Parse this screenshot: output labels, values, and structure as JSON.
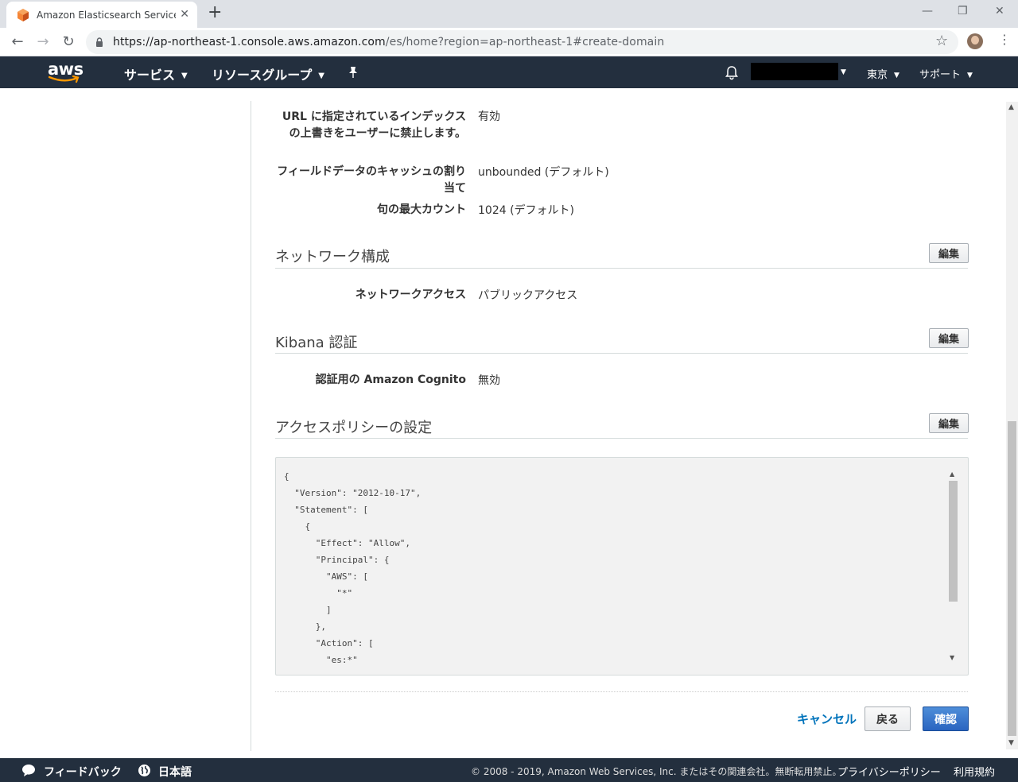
{
  "browser": {
    "tab_title": "Amazon Elasticsearch Service Ma",
    "url_host": "https://ap-northeast-1.console.aws.amazon.com",
    "url_path": "/es/home?region=ap-northeast-1#create-domain"
  },
  "aws_header": {
    "logo_text": "aws",
    "services_label": "サービス",
    "resource_groups_label": "リソースグループ",
    "region_label": "東京",
    "support_label": "サポート"
  },
  "advanced": {
    "rows": [
      {
        "label": "URL に指定されているインデックスの上書きをユーザーに禁止します。",
        "value": "有効"
      },
      {
        "label": "フィールドデータのキャッシュの割り当て",
        "value": "unbounded (デフォルト)"
      },
      {
        "label": "句の最大カウント",
        "value": "1024 (デフォルト)"
      }
    ]
  },
  "network": {
    "title": "ネットワーク構成",
    "edit_label": "編集",
    "label": "ネットワークアクセス",
    "value": "パブリックアクセス"
  },
  "kibana": {
    "title": "Kibana 認証",
    "edit_label": "編集",
    "label": "認証用の Amazon Cognito",
    "value": "無効"
  },
  "policy": {
    "title": "アクセスポリシーの設定",
    "edit_label": "編集",
    "lines": [
      "{",
      "  \"Version\": \"2012-10-17\",",
      "  \"Statement\": [",
      "    {",
      "      \"Effect\": \"Allow\",",
      "      \"Principal\": {",
      "        \"AWS\": [",
      "          \"*\"",
      "        ]",
      "      },",
      "      \"Action\": [",
      "        \"es:*\""
    ]
  },
  "actions": {
    "cancel_label": "キャンセル",
    "back_label": "戻る",
    "confirm_label": "確認"
  },
  "footer": {
    "feedback_label": "フィードバック",
    "language_label": "日本語",
    "copyright": "© 2008 - 2019, Amazon Web Services, Inc. またはその関連会社。無断転用禁止。",
    "privacy_label": "プライバシーポリシー",
    "terms_label": "利用規約"
  },
  "colors": {
    "aws_nav_bg": "#232f3e",
    "aws_orange": "#ff9900",
    "link_blue": "#0073bb",
    "primary_button": "#2a64c0"
  }
}
